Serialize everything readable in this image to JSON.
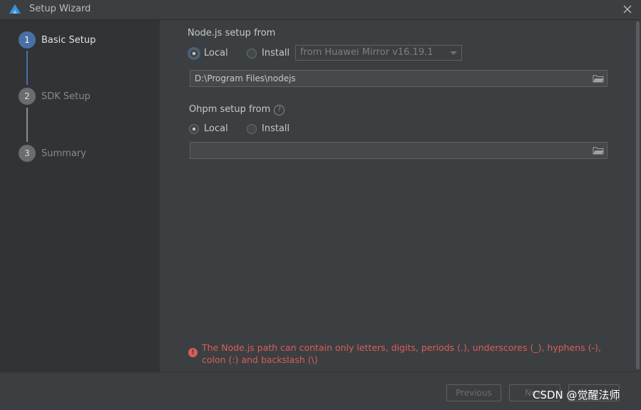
{
  "window": {
    "title": "Setup Wizard"
  },
  "icons": {
    "logo": "app-logo-icon",
    "close": "close-icon",
    "folder": "folder-icon",
    "help": "help-icon",
    "error": "error-icon"
  },
  "colors": {
    "accent": "#4a6fa5",
    "error": "#db5c5c",
    "sidebar_bg": "#313335",
    "content_bg": "#3c3f41"
  },
  "steps": [
    {
      "number": "1",
      "label": "Basic Setup",
      "active": true
    },
    {
      "number": "2",
      "label": "SDK Setup",
      "active": false
    },
    {
      "number": "3",
      "label": "Summary",
      "active": false
    }
  ],
  "nodejs": {
    "title": "Node.js setup from",
    "options": {
      "local": "Local",
      "install": "Install"
    },
    "selected": "local",
    "mirror": "from Huawei Mirror v16.19.1",
    "path": "D:\\Program Files\\nodejs"
  },
  "ohpm": {
    "title": "Ohpm setup from",
    "help": "?",
    "options": {
      "local": "Local",
      "install": "Install"
    },
    "selected": "local",
    "path": ""
  },
  "error": {
    "message": "The Node.js path can contain only letters, digits, periods (.), underscores (_), hyphens (-), colon (:) and backslash (\\)"
  },
  "buttons": {
    "previous": "Previous",
    "next": "Next"
  },
  "watermark": "CSDN @觉醒法师"
}
